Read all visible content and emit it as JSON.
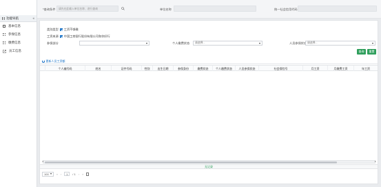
{
  "sidebar": {
    "title": "功能导航",
    "collapse": "«",
    "items": [
      {
        "label": "基本信息",
        "icon": "square-icon"
      },
      {
        "label": "参保信息",
        "icon": "grid-icon"
      },
      {
        "label": "缴费信息",
        "icon": "grid-icon"
      },
      {
        "label": "员工信息",
        "icon": "external-link-icon"
      }
    ]
  },
  "topbar": {
    "field1_label": "*查询条件",
    "field1_placeholder": "请先在此输入单位名称、进行查询",
    "field2_label": "单位名称",
    "field2_value": "",
    "field3_label": "统一社会信用代码",
    "field3_value": ""
  },
  "form": {
    "category_label": "类别类型",
    "category_value": "工资不够缴",
    "unit_label": "工资来源",
    "unit_value": "中国工商银行股份有限公司和你好行",
    "insured_label": "参保部分",
    "insured_value": "",
    "personal_label": "个人缴费状态",
    "personal_value": "请选择...",
    "status_label": "人员参保状态",
    "status_value": "请选择..."
  },
  "buttons": {
    "query": "查询",
    "reset": "重置"
  },
  "refresh_label": "更新人员工资额",
  "table": {
    "columns": [
      "个人编号码",
      "姓名",
      "证件号码",
      "性别",
      "出生日期",
      "参保身份",
      "缴费状态",
      "个人缴费状态",
      "人员参保状态",
      "社会保险号",
      "月工资",
      "月缴费工资",
      "年工资"
    ],
    "empty_text": "无记录"
  },
  "pager": {
    "size": "100",
    "prev_first": "«",
    "prev": "‹",
    "page": "1",
    "total": "/ 1",
    "next": "›",
    "next_last": "»"
  },
  "colors": {
    "accent": "#2e9e5b",
    "link": "#1a73c7"
  }
}
